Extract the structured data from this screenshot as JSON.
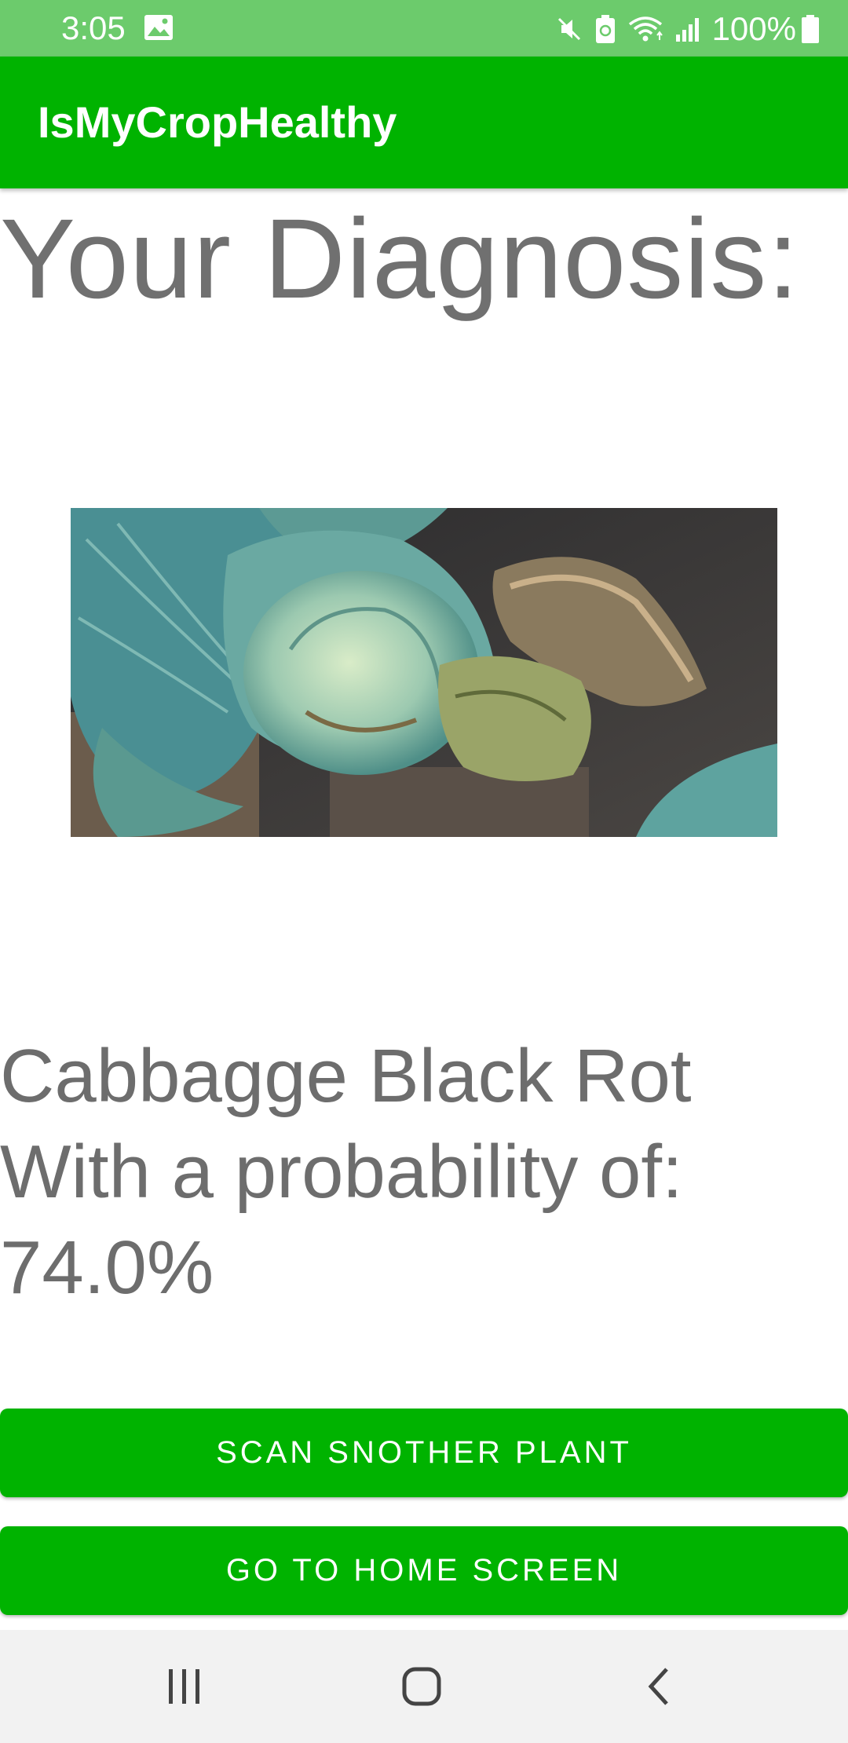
{
  "status_bar": {
    "time": "3:05",
    "battery": "100%",
    "icons": [
      "image-icon",
      "mute-icon",
      "battery-saver-icon",
      "wifi-icon",
      "signal-icon",
      "battery-icon"
    ]
  },
  "app_bar": {
    "title": "IsMyCropHealthy"
  },
  "diagnosis": {
    "heading": "Your Diagnosis:",
    "disease": "Cabbagge Black Rot",
    "probability_label": "With a probability of:",
    "probability": "74.0%"
  },
  "buttons": {
    "scan_another": "SCAN SNOTHER PLANT",
    "home": "GO TO HOME SCREEN"
  },
  "colors": {
    "status_bar": "#6ccb6c",
    "primary": "#00b300",
    "text_gray": "#707070",
    "nav_bar": "#f2f2f2"
  },
  "nav_bar": {
    "icons": [
      "recent-apps-icon",
      "home-icon",
      "back-icon"
    ]
  }
}
